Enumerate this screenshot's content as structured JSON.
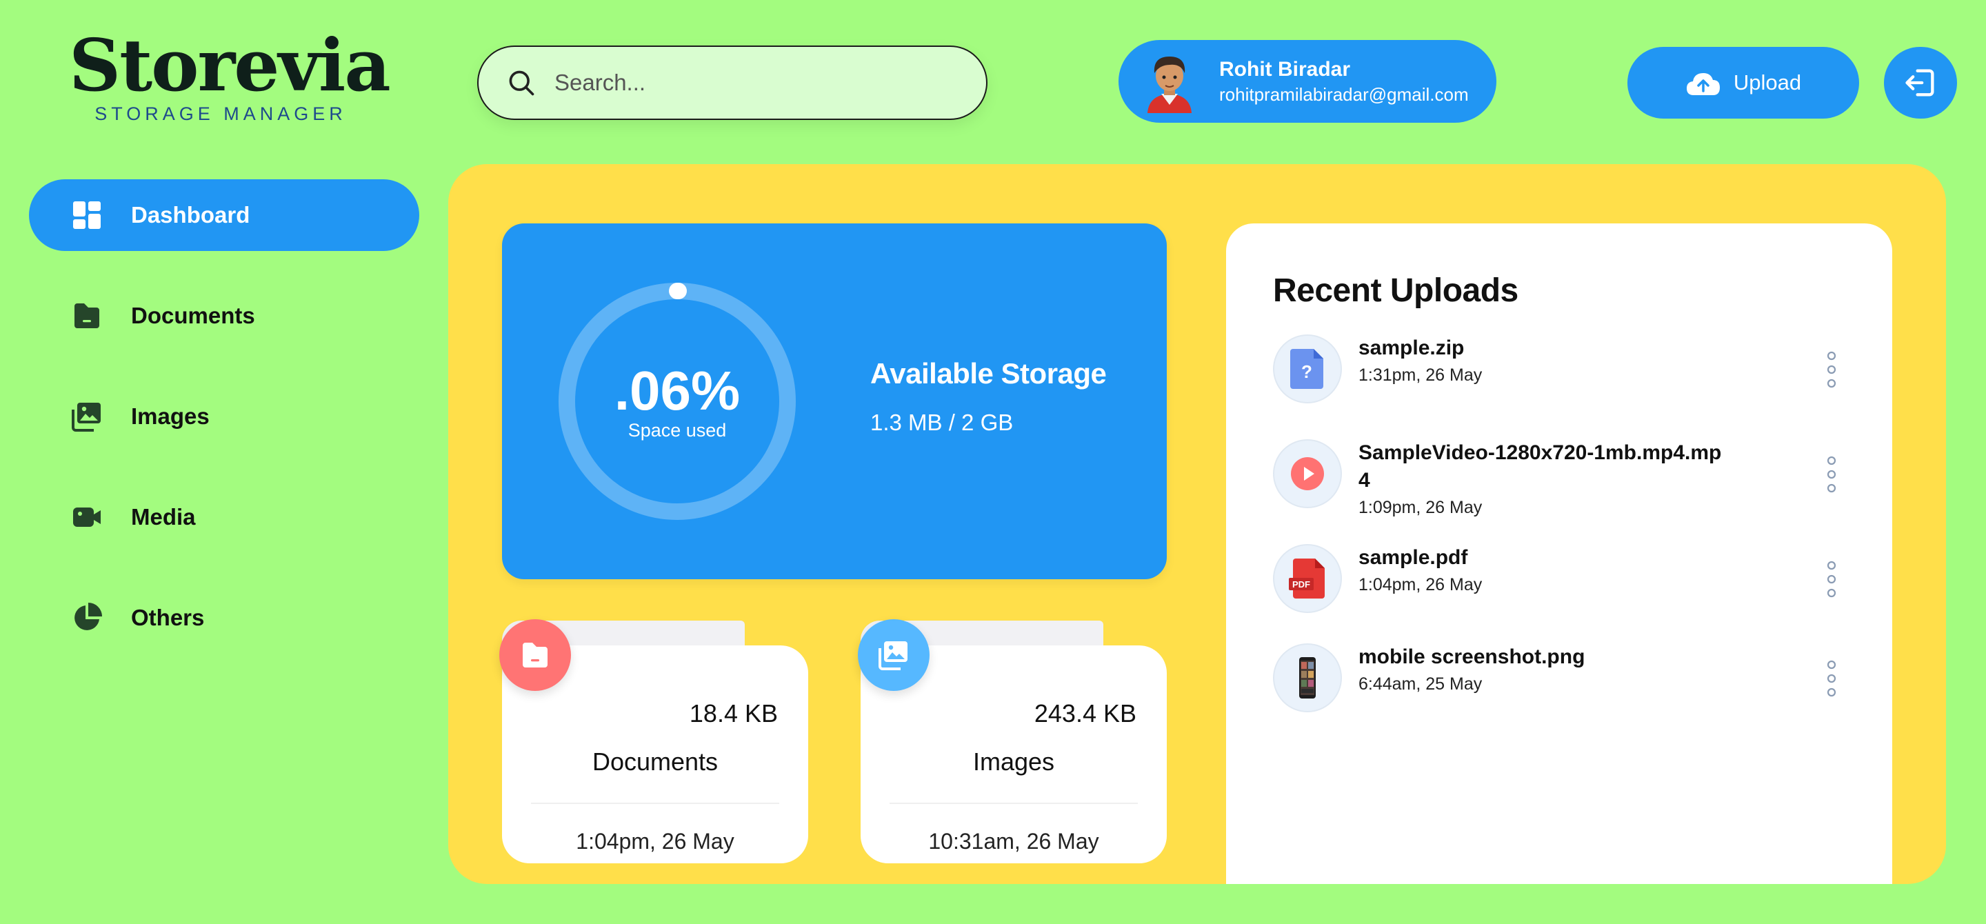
{
  "app": {
    "logo_title": "Storevia",
    "logo_subtitle": "STORAGE MANAGER"
  },
  "search": {
    "placeholder": "Search..."
  },
  "user": {
    "name": "Rohit Biradar",
    "email": "rohitpramilabiradar@gmail.com"
  },
  "header": {
    "upload_label": "Upload",
    "upload_icon": "cloud-upload-icon",
    "logout_icon": "logout-icon"
  },
  "sidebar": {
    "items": [
      {
        "label": "Dashboard",
        "icon": "dashboard-icon",
        "active": true
      },
      {
        "label": "Documents",
        "icon": "document-folder-icon"
      },
      {
        "label": "Images",
        "icon": "images-icon"
      },
      {
        "label": "Media",
        "icon": "video-camera-icon"
      },
      {
        "label": "Others",
        "icon": "pie-chart-icon"
      }
    ]
  },
  "storage": {
    "percent": ".06%",
    "percent_label": "Space used",
    "used_fraction": 0.0006,
    "title": "Available Storage",
    "size": "1.3 MB / 2 GB"
  },
  "categories": [
    {
      "size": "18.4 KB",
      "name": "Documents",
      "time": "1:04pm, 26 May",
      "icon": "document-folder-icon",
      "color": "#ff7474"
    },
    {
      "size": "243.4 KB",
      "name": "Images",
      "time": "10:31am, 26 May",
      "icon": "images-icon",
      "color": "#56b8ff"
    }
  ],
  "recent": {
    "title": "Recent Uploads",
    "files": [
      {
        "name": "sample.zip",
        "time": "1:31pm, 26 May",
        "icon": "unknown-file-icon"
      },
      {
        "name": "SampleVideo-1280x720-1mb.mp4.mp4",
        "time": "1:09pm, 26 May",
        "icon": "video-play-icon"
      },
      {
        "name": "sample.pdf",
        "time": "1:04pm, 26 May",
        "icon": "pdf-file-icon"
      },
      {
        "name": "mobile screenshot.png",
        "time": "6:44am, 25 May",
        "icon": "phone-screenshot-thumbnail"
      }
    ]
  },
  "colors": {
    "background": "#a3fc7f",
    "primary": "#2196f3",
    "panel": "#ffdf4a",
    "documents_accent": "#ff7474",
    "images_accent": "#56b8ff"
  }
}
